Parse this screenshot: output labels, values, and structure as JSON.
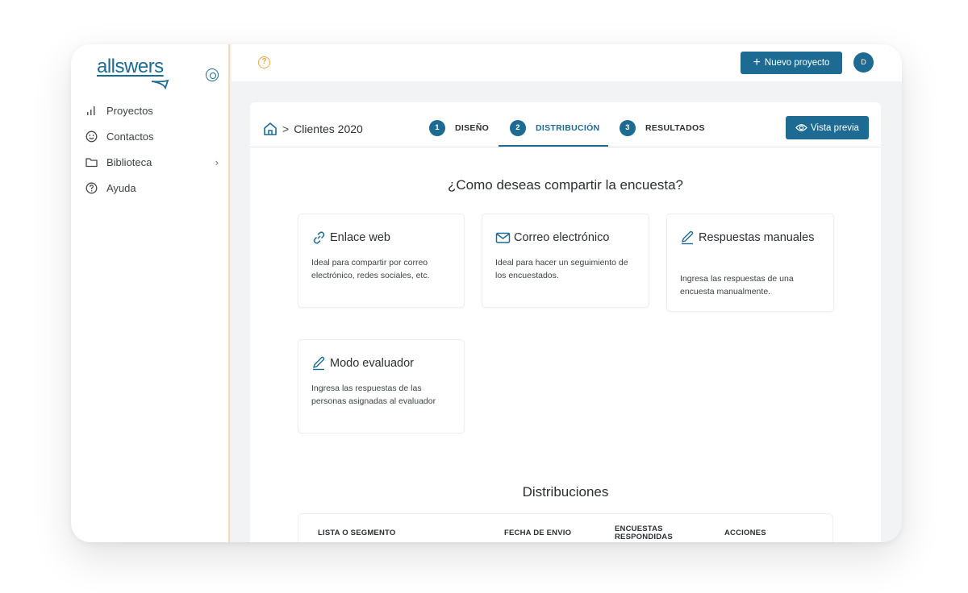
{
  "sidebar": {
    "logo": "allswers",
    "items": [
      {
        "label": "Proyectos",
        "icon": "bar-chart-icon"
      },
      {
        "label": "Contactos",
        "icon": "smile-icon"
      },
      {
        "label": "Biblioteca",
        "icon": "folder-icon",
        "chevron": "›"
      },
      {
        "label": "Ayuda",
        "icon": "help-circle-icon"
      }
    ]
  },
  "topbar": {
    "help_icon": "?",
    "new_project_label": "Nuevo proyecto",
    "new_project_icon": "+",
    "avatar_initial": "D"
  },
  "header": {
    "breadcrumb_separator": ">",
    "breadcrumb_project": "Clientes 2020",
    "steps": [
      {
        "num": "1",
        "label": "DISEÑO"
      },
      {
        "num": "2",
        "label": "DISTRIBUCIÓN",
        "active": true
      },
      {
        "num": "3",
        "label": "RESULTADOS"
      }
    ],
    "preview_label": "Vista previa"
  },
  "main": {
    "question": "¿Como deseas compartir la encuesta?",
    "options": [
      {
        "title": "Enlace web",
        "icon": "link-icon",
        "description": "Ideal para compartir por correo electrónico, redes sociales, etc."
      },
      {
        "title": "Correo electrónico",
        "icon": "mail-icon",
        "description": "Ideal para hacer un seguimiento de los encuestados."
      },
      {
        "title": "Respuestas manuales",
        "icon": "pen-icon",
        "description": "Ingresa las respuestas de una encuesta manualmente."
      },
      {
        "title": "Modo evaluador",
        "icon": "pen-icon",
        "description": "Ingresa las respuestas de las personas asignadas al evaluador"
      }
    ],
    "distributions_title": "Distribuciones",
    "table_headers": [
      "LISTA O SEGMENTO",
      "FECHA DE ENVIO",
      "ENCUESTAS RESPONDIDAS",
      "ACCIONES"
    ]
  },
  "colors": {
    "accent": "#1d6a93",
    "warning": "#f0a540"
  }
}
